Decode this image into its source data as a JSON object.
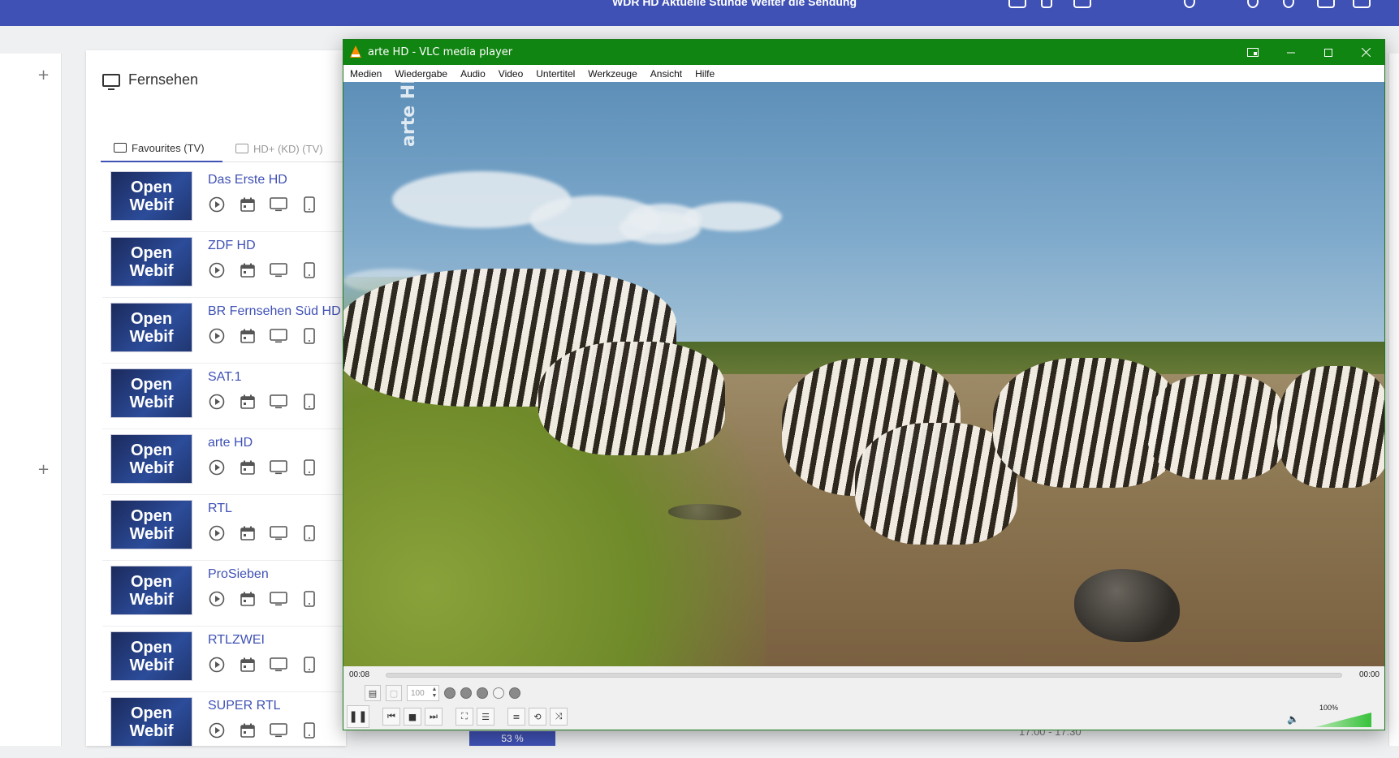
{
  "webif": {
    "topbar": {
      "text": "WDR HD  Aktuelle Stunde  Weiter die Sendung"
    },
    "panel": {
      "title": "Fernsehen",
      "tabs": [
        {
          "label": "Favourites (TV)"
        },
        {
          "label": "HD+ (KD) (TV)"
        }
      ]
    },
    "logo_text": {
      "line1": "Open",
      "line2": "Webif"
    },
    "channels": [
      {
        "name": "Das Erste HD"
      },
      {
        "name": "ZDF HD"
      },
      {
        "name": "BR Fernsehen Süd HD"
      },
      {
        "name": "SAT.1"
      },
      {
        "name": "arte HD"
      },
      {
        "name": "RTL"
      },
      {
        "name": "ProSieben"
      },
      {
        "name": "RTLZWEI"
      },
      {
        "name": "SUPER RTL"
      }
    ],
    "progress_pill": "53 %",
    "bottom_time": "17:00 - 17:30"
  },
  "vlc": {
    "title": "arte HD - VLC media player",
    "menu": [
      "Medien",
      "Wiedergabe",
      "Audio",
      "Video",
      "Untertitel",
      "Werkzeuge",
      "Ansicht",
      "Hilfe"
    ],
    "watermark": "arte HD",
    "time_elapsed": "00:08",
    "time_total": "00:00",
    "speed_value": "100",
    "volume_label": "100%",
    "seek_progress": 0.0
  }
}
